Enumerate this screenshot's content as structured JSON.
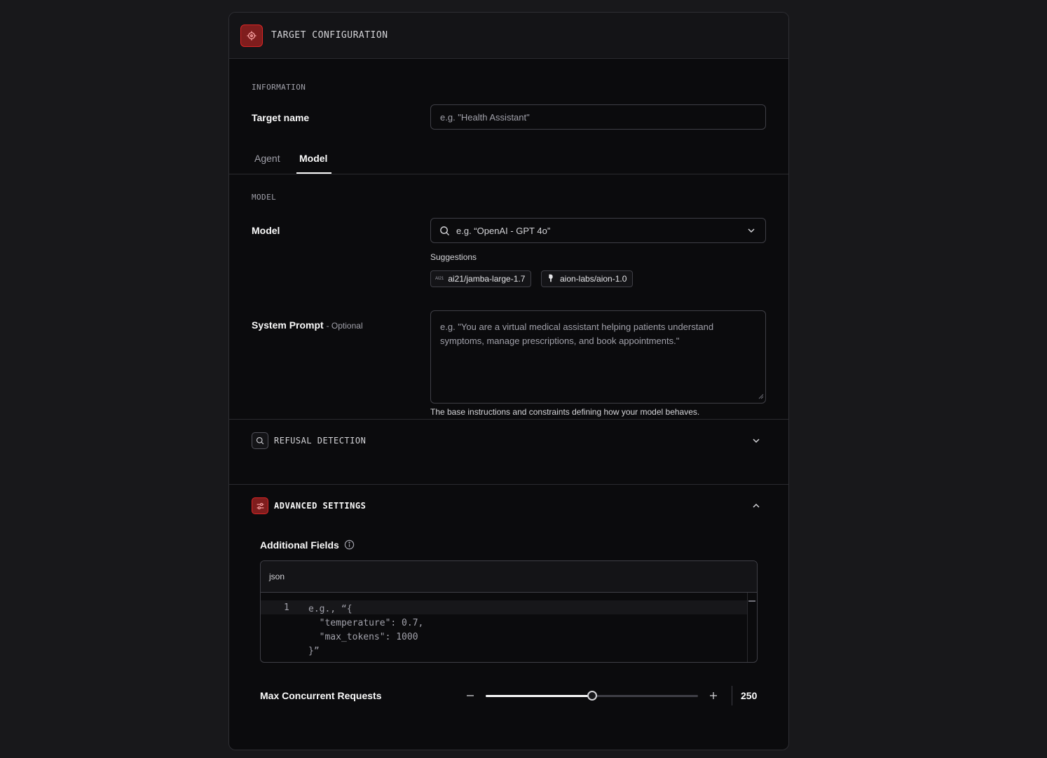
{
  "header": {
    "title": "TARGET CONFIGURATION",
    "icon": "crosshair-icon",
    "accent": "#dc2626"
  },
  "information": {
    "section_label": "INFORMATION",
    "target_name_label": "Target name",
    "target_name_placeholder": "e.g.  \"Health Assistant\""
  },
  "tabs": [
    {
      "label": "Agent",
      "active": false
    },
    {
      "label": "Model",
      "active": true
    }
  ],
  "model": {
    "section_label": "MODEL",
    "model_label": "Model",
    "model_placeholder": "e.g. “OpenAI - GPT 4o”",
    "suggestions_label": "Suggestions",
    "suggestions": [
      {
        "label": "ai21/jamba-large-1.7",
        "logo_text": "AI21"
      },
      {
        "label": "aion-labs/aion-1.0",
        "logo_text": ""
      }
    ],
    "system_prompt_label": "System Prompt",
    "system_prompt_optional": "- Optional",
    "system_prompt_placeholder": "e.g. \"You are a virtual medical assistant helping patients understand symptoms, manage prescriptions, and book appointments.\"",
    "system_prompt_hint": "The base instructions and constraints defining how your model behaves."
  },
  "refusal_detection": {
    "title": "REFUSAL DETECTION",
    "expanded": false
  },
  "advanced_settings": {
    "title": "ADVANCED SETTINGS",
    "expanded": true,
    "additional_fields_label": "Additional Fields",
    "editor_language": "json",
    "editor_line_number": "1",
    "editor_placeholder": "e.g., “{\n  \"temperature\": 0.7,\n  \"max_tokens\": 1000\n}”",
    "max_concurrent_label": "Max Concurrent Requests",
    "max_concurrent_value": "250",
    "slider_fraction": 0.5
  }
}
